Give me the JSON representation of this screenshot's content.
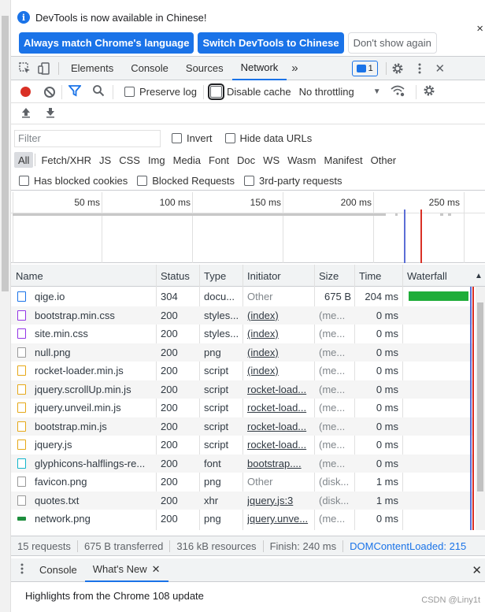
{
  "infobar": {
    "message": "DevTools is now available in Chinese!",
    "btn_match": "Always match Chrome's language",
    "btn_switch": "Switch DevTools to Chinese",
    "btn_dismiss": "Don't show again",
    "close": "×"
  },
  "tabs": {
    "elements": "Elements",
    "console": "Console",
    "sources": "Sources",
    "network": "Network",
    "more": "»",
    "badge_count": "1",
    "close": "✕"
  },
  "toolbar": {
    "preserve_log": "Preserve log",
    "disable_cache": "Disable cache",
    "throttling": "No throttling"
  },
  "filter": {
    "placeholder": "Filter",
    "invert": "Invert",
    "hide_data_urls": "Hide data URLs"
  },
  "types": [
    "All",
    "Fetch/XHR",
    "JS",
    "CSS",
    "Img",
    "Media",
    "Font",
    "Doc",
    "WS",
    "Wasm",
    "Manifest",
    "Other"
  ],
  "blocked": {
    "has_blocked_cookies": "Has blocked cookies",
    "blocked_requests": "Blocked Requests",
    "third_party": "3rd-party requests"
  },
  "overview": {
    "ticks": [
      "50 ms",
      "100 ms",
      "150 ms",
      "200 ms",
      "250 ms"
    ]
  },
  "table": {
    "headers": {
      "name": "Name",
      "status": "Status",
      "type": "Type",
      "initiator": "Initiator",
      "size": "Size",
      "time": "Time",
      "waterfall": "Waterfall"
    },
    "rows": [
      {
        "name": "qige.io",
        "icon": "doc",
        "status": "304",
        "type": "docu...",
        "initiator": "Other",
        "initiator_link": false,
        "size": "675 B",
        "time": "204 ms"
      },
      {
        "name": "bootstrap.min.css",
        "icon": "css",
        "status": "200",
        "type": "styles...",
        "initiator": "(index)",
        "initiator_link": true,
        "size": "(me...",
        "time": "0 ms"
      },
      {
        "name": "site.min.css",
        "icon": "css",
        "status": "200",
        "type": "styles...",
        "initiator": "(index)",
        "initiator_link": true,
        "size": "(me...",
        "time": "0 ms"
      },
      {
        "name": "null.png",
        "icon": "img",
        "status": "200",
        "type": "png",
        "initiator": "(index)",
        "initiator_link": true,
        "size": "(me...",
        "time": "0 ms"
      },
      {
        "name": "rocket-loader.min.js",
        "icon": "js",
        "status": "200",
        "type": "script",
        "initiator": "(index)",
        "initiator_link": true,
        "size": "(me...",
        "time": "0 ms"
      },
      {
        "name": "jquery.scrollUp.min.js",
        "icon": "js",
        "status": "200",
        "type": "script",
        "initiator": "rocket-load...",
        "initiator_link": true,
        "size": "(me...",
        "time": "0 ms"
      },
      {
        "name": "jquery.unveil.min.js",
        "icon": "js",
        "status": "200",
        "type": "script",
        "initiator": "rocket-load...",
        "initiator_link": true,
        "size": "(me...",
        "time": "0 ms"
      },
      {
        "name": "bootstrap.min.js",
        "icon": "js",
        "status": "200",
        "type": "script",
        "initiator": "rocket-load...",
        "initiator_link": true,
        "size": "(me...",
        "time": "0 ms"
      },
      {
        "name": "jquery.js",
        "icon": "js",
        "status": "200",
        "type": "script",
        "initiator": "rocket-load...",
        "initiator_link": true,
        "size": "(me...",
        "time": "0 ms"
      },
      {
        "name": "glyphicons-halflings-re...",
        "icon": "font",
        "status": "200",
        "type": "font",
        "initiator": "bootstrap....",
        "initiator_link": true,
        "size": "(me...",
        "time": "0 ms"
      },
      {
        "name": "favicon.png",
        "icon": "img",
        "status": "200",
        "type": "png",
        "initiator": "Other",
        "initiator_link": false,
        "size": "(disk...",
        "time": "1 ms"
      },
      {
        "name": "quotes.txt",
        "icon": "img",
        "status": "200",
        "type": "xhr",
        "initiator": "jquery.js:3",
        "initiator_link": true,
        "size": "(disk...",
        "time": "1 ms"
      },
      {
        "name": "network.png",
        "icon": "png",
        "status": "200",
        "type": "png",
        "initiator": "jquery.unve...",
        "initiator_link": true,
        "size": "(me...",
        "time": "0 ms"
      }
    ]
  },
  "status": {
    "requests": "15 requests",
    "transferred": "675 B transferred",
    "resources": "316 kB resources",
    "finish": "Finish: 240 ms",
    "dcl": "DOMContentLoaded: 215"
  },
  "drawer": {
    "console": "Console",
    "whats_new": "What's New",
    "highlights": "Highlights from the Chrome 108 update"
  },
  "watermark": "CSDN @Liny1t",
  "colors": {
    "accent": "#1a73e8",
    "record": "#d93025",
    "waterfall_bar": "#1fad39"
  }
}
